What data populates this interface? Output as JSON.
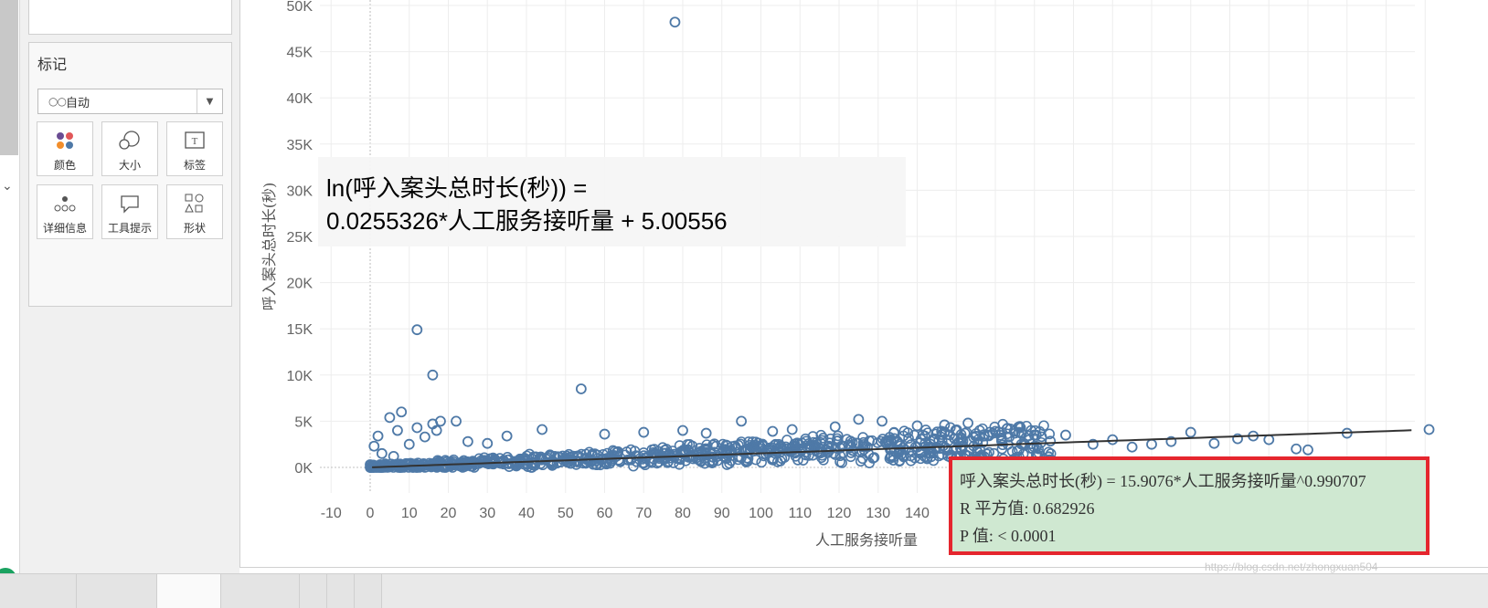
{
  "left_strip": {
    "chevron_icon": "chevron-down-icon"
  },
  "marks_card": {
    "title": "标记",
    "mark_type": "自动",
    "buttons": [
      {
        "label": "颜色",
        "icon": "color-dots-icon"
      },
      {
        "label": "大小",
        "icon": "size-circles-icon"
      },
      {
        "label": "标签",
        "icon": "text-label-icon"
      },
      {
        "label": "详细信息",
        "icon": "detail-dots-icon"
      },
      {
        "label": "工具提示",
        "icon": "tooltip-bubble-icon"
      },
      {
        "label": "形状",
        "icon": "shapes-icon"
      }
    ]
  },
  "colors": {
    "accent": "#4e79a7",
    "trend_line": "#333333",
    "tooltip_bg": "#cfe8d1",
    "tooltip_border": "#e5262e"
  },
  "equation_box": {
    "line1": "ln(呼入案头总时长(秒)) =",
    "line2": "0.0255326*人工服务接听量 + 5.00556"
  },
  "tooltip": {
    "line1": "呼入案头总时长(秒) = 15.9076*人工服务接听量^0.990707",
    "line2": "R 平方值: 0.682926",
    "line3": "P 值: < 0.0001"
  },
  "watermark": "https://blog.csdn.net/zhongxuan504",
  "chart_data": {
    "type": "scatter",
    "xlabel": "人工服务接听量",
    "ylabel": "呼入案头总时长(秒)",
    "xlim": [
      -13,
      272
    ],
    "ylim": [
      -2800,
      51000
    ],
    "x_ticks": [
      "-10",
      "0",
      "10",
      "20",
      "30",
      "40",
      "50",
      "60",
      "70",
      "80",
      "90",
      "100",
      "110",
      "120",
      "130",
      "140"
    ],
    "y_ticks": [
      "0K",
      "5K",
      "10K",
      "15K",
      "20K",
      "25K",
      "30K",
      "35K",
      "40K",
      "45K",
      "50K"
    ],
    "grid": true,
    "trend_line": {
      "model": "power",
      "coefficient": 15.9076,
      "exponent": 0.990707
    },
    "points": [
      [
        0,
        300
      ],
      [
        1,
        2300
      ],
      [
        2,
        3400
      ],
      [
        3,
        1500
      ],
      [
        5,
        5400
      ],
      [
        6,
        1200
      ],
      [
        7,
        4000
      ],
      [
        8,
        6000
      ],
      [
        10,
        2500
      ],
      [
        12,
        14900
      ],
      [
        12,
        4300
      ],
      [
        14,
        3300
      ],
      [
        16,
        10000
      ],
      [
        16,
        4700
      ],
      [
        17,
        4000
      ],
      [
        18,
        5000
      ],
      [
        22,
        5000
      ],
      [
        25,
        2800
      ],
      [
        30,
        2600
      ],
      [
        35,
        3400
      ],
      [
        44,
        4100
      ],
      [
        54,
        8500
      ],
      [
        60,
        3600
      ],
      [
        70,
        3800
      ],
      [
        78,
        48200
      ],
      [
        80,
        4000
      ],
      [
        86,
        3700
      ],
      [
        95,
        5000
      ],
      [
        103,
        3900
      ],
      [
        108,
        4100
      ],
      [
        119,
        4400
      ],
      [
        125,
        5200
      ],
      [
        131,
        5000
      ],
      [
        140,
        4500
      ],
      [
        147,
        4600
      ],
      [
        150,
        2000
      ],
      [
        153,
        4800
      ],
      [
        160,
        3900
      ],
      [
        166,
        3800
      ],
      [
        170,
        3500
      ],
      [
        178,
        3500
      ],
      [
        185,
        2500
      ],
      [
        190,
        3000
      ],
      [
        195,
        2200
      ],
      [
        200,
        2500
      ],
      [
        205,
        2800
      ],
      [
        210,
        3800
      ],
      [
        216,
        2600
      ],
      [
        222,
        3100
      ],
      [
        226,
        3400
      ],
      [
        230,
        3000
      ],
      [
        237,
        2000
      ],
      [
        240,
        1900
      ],
      [
        250,
        3700
      ],
      [
        271,
        4100
      ]
    ]
  }
}
